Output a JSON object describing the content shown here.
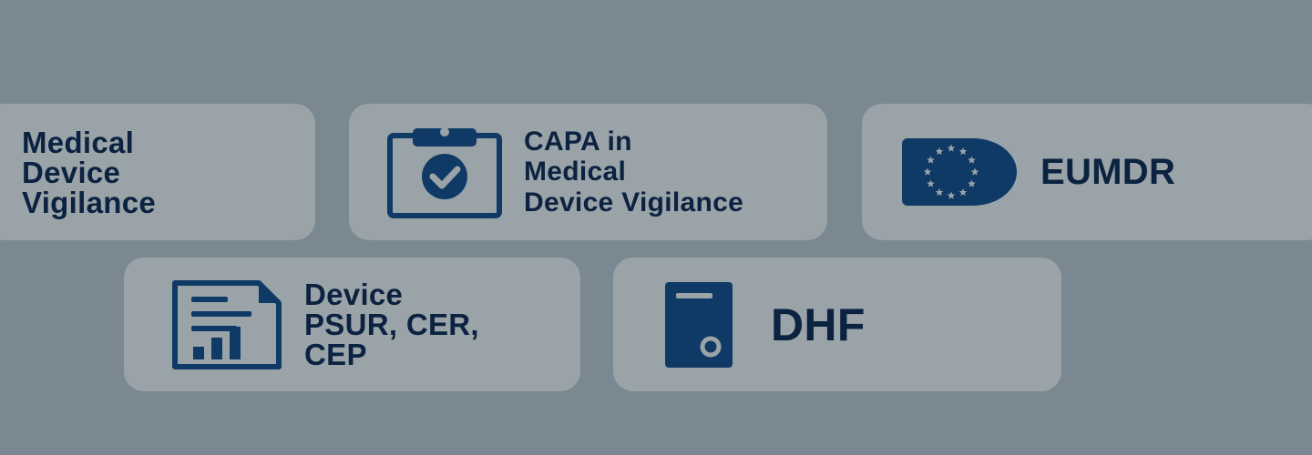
{
  "colors": {
    "background": "#7a8892",
    "card": "#9aa3a8",
    "accent": "#0f3a66",
    "text": "#0b2240"
  },
  "cards": [
    {
      "id": "vigilance",
      "icon": "none",
      "lines": [
        "Medical",
        "Device",
        "Vigilance"
      ]
    },
    {
      "id": "capa",
      "icon": "clipboard-check-icon",
      "lines": [
        "CAPA in",
        "Medical",
        "Device Vigilance"
      ]
    },
    {
      "id": "eumdr",
      "icon": "eu-flag-icon",
      "lines": [
        "EUMDR"
      ]
    },
    {
      "id": "psur",
      "icon": "document-chart-icon",
      "lines": [
        "Device",
        "PSUR, CER,",
        "CEP"
      ]
    },
    {
      "id": "dhf",
      "icon": "server-icon",
      "lines": [
        "DHF"
      ]
    }
  ]
}
